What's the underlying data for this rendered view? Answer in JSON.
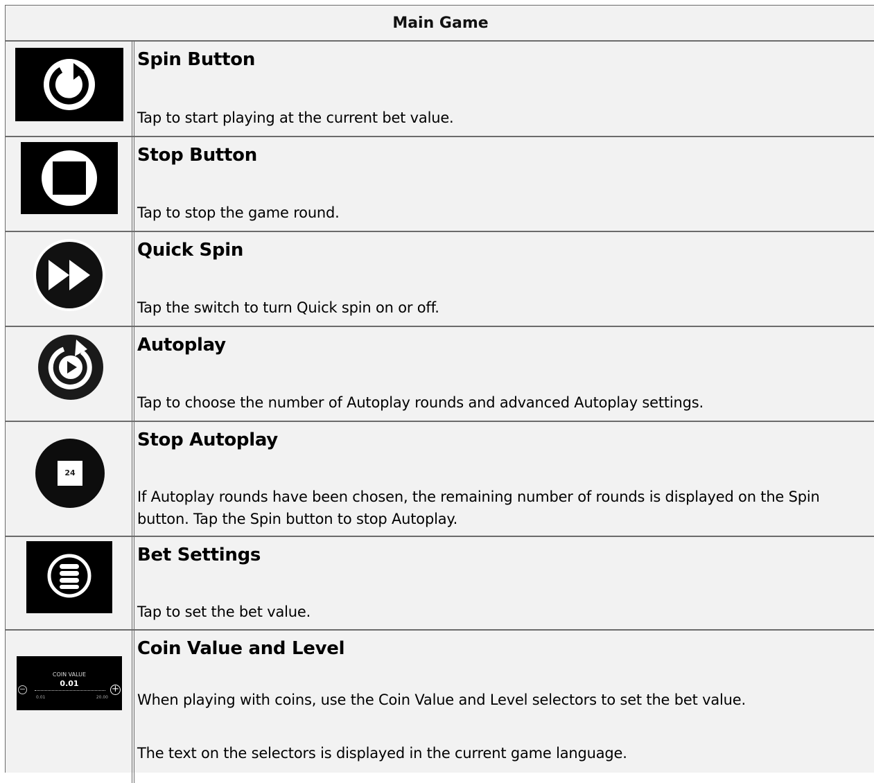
{
  "header": {
    "title": "Main Game"
  },
  "items": [
    {
      "icon": "spin-icon",
      "title": "Spin Button",
      "desc": "Tap to start playing at the current bet value."
    },
    {
      "icon": "stop-icon",
      "title": "Stop Button",
      "desc": "Tap to stop the game round."
    },
    {
      "icon": "quick-spin-icon",
      "title": "Quick Spin",
      "desc": "Tap the switch to turn Quick spin on or off."
    },
    {
      "icon": "autoplay-icon",
      "title": "Autoplay",
      "desc": "Tap to choose the number of Autoplay rounds and advanced Autoplay settings."
    },
    {
      "icon": "stop-autoplay-icon",
      "title": "Stop Autoplay",
      "desc": "If Autoplay rounds have been chosen, the remaining number of rounds is displayed on the Spin button. Tap the Spin button to stop Autoplay.",
      "badge": "24"
    },
    {
      "icon": "bet-settings-icon",
      "title": "Bet Settings",
      "desc": "Tap to set the bet value."
    },
    {
      "icon": "coin-value-icon",
      "title": "Coin Value and Level",
      "desc": "When playing with coins, use the Coin Value and Level selectors to set the bet value.",
      "desc2": "The text on the selectors is displayed in the current game language.",
      "widget": {
        "label": "COIN VALUE",
        "value": "0.01",
        "min": "0.01",
        "max": "20.00"
      }
    }
  ],
  "colors": {
    "border": "#6b6b6b",
    "background": "#f2f2f2",
    "icon_bg": "#000000"
  }
}
